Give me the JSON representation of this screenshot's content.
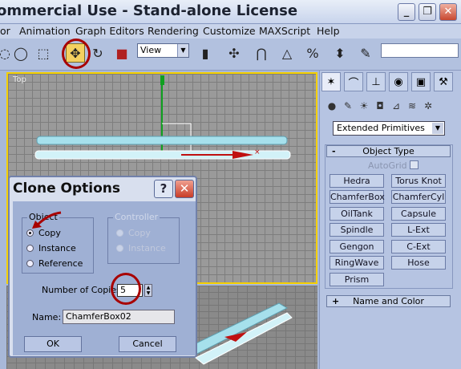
{
  "window": {
    "title": "ommercial Use - Stand-alone License",
    "controls": [
      "_",
      "❐",
      "✕"
    ]
  },
  "menu": [
    "or",
    "Animation",
    "Graph Editors",
    "Rendering",
    "Customize",
    "MAXScript",
    "Help"
  ],
  "toolbar": {
    "view_value": "View"
  },
  "viewport": {
    "label": "Top"
  },
  "command_panel": {
    "category": "Extended Primitives",
    "object_type_label": "Object Type",
    "autogrid_label": "AutoGrid",
    "primitives": [
      "Hedra",
      "Torus Knot",
      "ChamferBox",
      "ChamferCyl",
      "OilTank",
      "Capsule",
      "Spindle",
      "L-Ext",
      "Gengon",
      "C-Ext",
      "RingWave",
      "Hose",
      "Prism"
    ],
    "name_color_label": "Name and Color",
    "collapse_symbol": "-",
    "expand_symbol": "+"
  },
  "dialog": {
    "title": "Clone Options",
    "help": "?",
    "close": "✕",
    "object_group": "Object",
    "object_options": [
      "Copy",
      "Instance",
      "Reference"
    ],
    "controller_group": "Controller",
    "controller_options": [
      "Copy",
      "Instance"
    ],
    "copies_label": "Number of Copies:",
    "copies_value": "5",
    "name_label": "Name:",
    "name_value": "ChamferBox02",
    "ok": "OK",
    "cancel": "Cancel"
  },
  "colors": {
    "accent": "#f5d000",
    "annotation": "#a80000",
    "viewport_bg": "#9a9a9a"
  }
}
